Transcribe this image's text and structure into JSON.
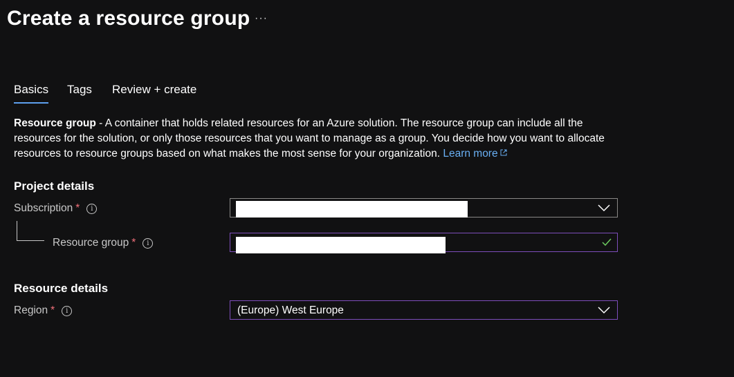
{
  "header": {
    "title": "Create a resource group",
    "more": "···"
  },
  "tabs": [
    {
      "label": "Basics",
      "active": true
    },
    {
      "label": "Tags",
      "active": false
    },
    {
      "label": "Review + create",
      "active": false
    }
  ],
  "description": {
    "bold": "Resource group",
    "text": " - A container that holds related resources for an Azure solution. The resource group can include all the resources for the solution, or only those resources that you want to manage as a group. You decide how you want to allocate resources to resource groups based on what makes the most sense for your organization. ",
    "link": "Learn more"
  },
  "project_details": {
    "heading": "Project details",
    "subscription": {
      "label": "Subscription",
      "required": "*",
      "value": ""
    },
    "resource_group": {
      "label": "Resource group",
      "required": "*",
      "value": ""
    }
  },
  "resource_details": {
    "heading": "Resource details",
    "region": {
      "label": "Region",
      "required": "*",
      "value": "(Europe) West Europe"
    }
  },
  "info_glyph": "i",
  "colors": {
    "background": "#111112",
    "accent_tab": "#5ea0ef",
    "link": "#69aff3",
    "required": "#f1707a",
    "focus_border": "#7e4ebc",
    "valid_check": "#6ccb5f"
  }
}
